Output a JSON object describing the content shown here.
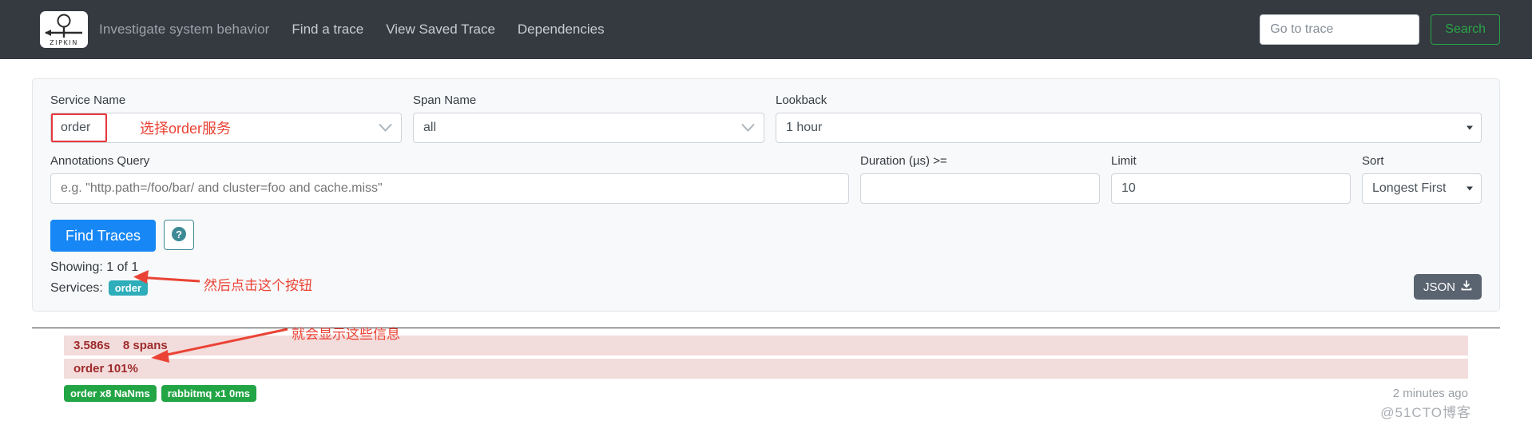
{
  "navbar": {
    "logo_alt": "ZIPKIN",
    "logo_wordmark": "ZIPKIN",
    "tagline": "Investigate system behavior",
    "links": [
      {
        "label": "Find a trace"
      },
      {
        "label": "View Saved Trace"
      },
      {
        "label": "Dependencies"
      }
    ],
    "goto_placeholder": "Go to trace",
    "goto_value": "",
    "search_label": "Search",
    "bg_color": "#343a40",
    "search_color": "#28a745"
  },
  "search_form": {
    "service_name": {
      "label": "Service Name",
      "value": "order",
      "annotation": "选择order服务"
    },
    "span_name": {
      "label": "Span Name",
      "value": "all"
    },
    "lookback": {
      "label": "Lookback",
      "value": "1 hour"
    },
    "annotations_query": {
      "label": "Annotations Query",
      "value": "",
      "placeholder": "e.g. \"http.path=/foo/bar/ and cluster=foo and cache.miss\""
    },
    "duration": {
      "label": "Duration (µs) >=",
      "value": "",
      "placeholder": ""
    },
    "limit": {
      "label": "Limit",
      "value": "10"
    },
    "sort": {
      "label": "Sort",
      "value": "Longest First"
    },
    "find_traces_label": "Find Traces",
    "help_icon": "question-circle-icon",
    "find_traces_color": "#1787f5"
  },
  "results_meta": {
    "showing": "Showing: 1 of 1",
    "services_label": "Services:",
    "service_badge": "order",
    "json_label": "JSON",
    "json_icon": "download-icon"
  },
  "trace": {
    "duration": "3.586s",
    "spans": "8 spans",
    "service_line": "order 101%",
    "badges": [
      {
        "label": "order x8 NaNms"
      },
      {
        "label": "rabbitmq x1 0ms"
      }
    ],
    "timestamp": "2 minutes ago",
    "bar_color": "#f3dcdc",
    "badge_color": "#22a544"
  },
  "annotations": {
    "click_button": "然后点击这个按钮",
    "show_info": "就会显示这些信息",
    "color": "#ea4335"
  },
  "watermark": "@51CTO博客"
}
